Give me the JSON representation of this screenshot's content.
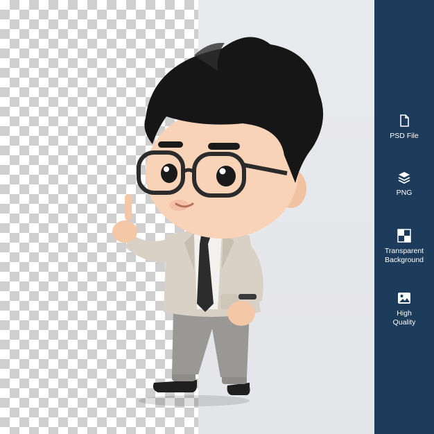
{
  "features": [
    {
      "label": "PSD File",
      "icon": "document-icon"
    },
    {
      "label": "PNG",
      "icon": "layers-icon"
    },
    {
      "label": "Transparent\nBackground",
      "icon": "checkerboard-icon"
    },
    {
      "label": "High\nQuality",
      "icon": "image-icon"
    }
  ],
  "colors": {
    "sidebar": "#1d3b5a",
    "checker": "#cfcfcf",
    "plain_bg": "#e6e7eb"
  }
}
